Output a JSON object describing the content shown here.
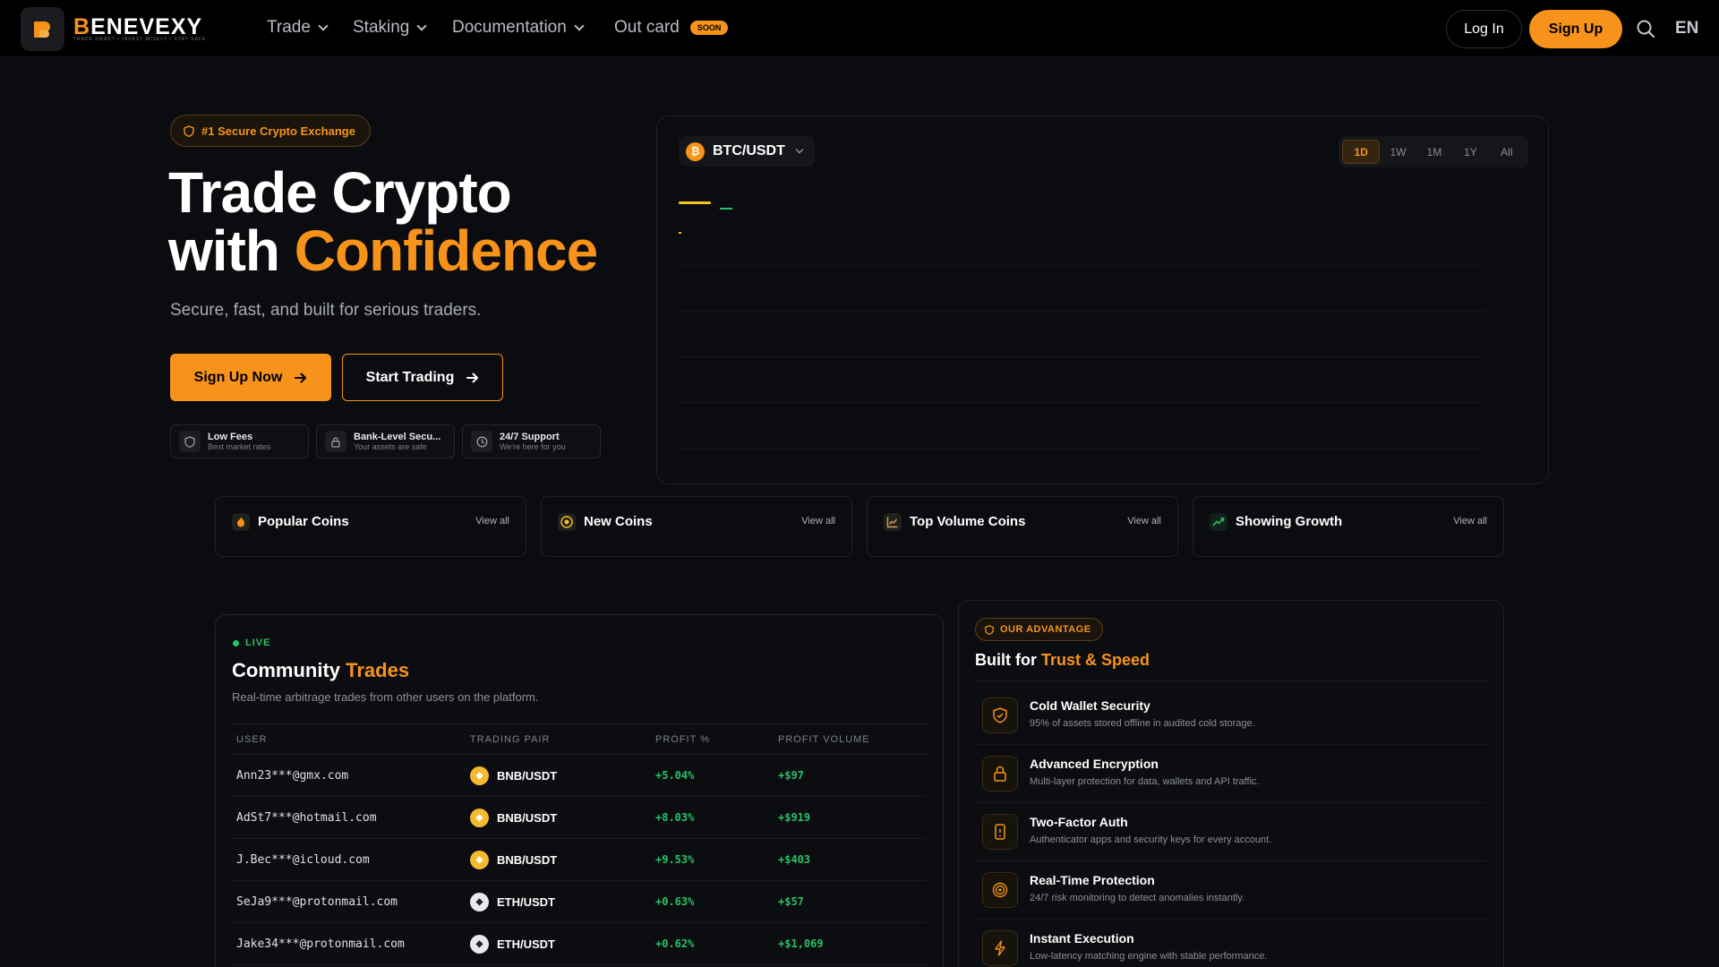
{
  "nav": {
    "brand_first": "B",
    "brand_rest": "ENEVEXY",
    "tagline": "TRADE SMART • INVEST WISELY • STAY SAFE",
    "items": [
      {
        "label": "Trade"
      },
      {
        "label": "Staking"
      },
      {
        "label": "Documentation"
      },
      {
        "label": "Out card"
      }
    ],
    "soon_badge": "SOON",
    "login": "Log In",
    "signup": "Sign Up",
    "language": "EN"
  },
  "hero": {
    "badge": "#1 Secure Crypto Exchange",
    "title_line1": "Trade Crypto",
    "title_line2_plain": "with ",
    "title_line2_accent": "Confidence",
    "subtitle": "Secure, fast, and built for serious traders.",
    "primary_cta": "Sign Up Now",
    "secondary_cta": "Start Trading",
    "features": [
      {
        "title": "Low Fees",
        "subtitle": "Best market rates"
      },
      {
        "title": "Bank-Level Secu...",
        "subtitle": "Your assets are safe"
      },
      {
        "title": "24/7 Support",
        "subtitle": "We're here for you"
      }
    ]
  },
  "chart": {
    "pair": "BTC/USDT",
    "timeframes": [
      "1D",
      "1W",
      "1M",
      "1Y",
      "All"
    ],
    "active_timeframe": "1D"
  },
  "categories": [
    {
      "title": "Popular Coins",
      "link": "View all"
    },
    {
      "title": "New Coins",
      "link": "View all"
    },
    {
      "title": "Top Volume Coins",
      "link": "View all"
    },
    {
      "title": "Showing Growth",
      "link": "View all"
    }
  ],
  "trades": {
    "live_label": "LIVE",
    "title_plain": "Community ",
    "title_accent": "Trades",
    "subtitle": "Real-time arbitrage trades from other users on the platform.",
    "headers": [
      "USER",
      "TRADING PAIR",
      "PROFIT %",
      "PROFIT VOLUME"
    ],
    "rows": [
      {
        "user": "Ann23***@gmx.com",
        "pair": "BNB/USDT",
        "coin": "bnb",
        "profit_pct": "+5.04%",
        "profit_vol": "+$97"
      },
      {
        "user": "AdSt7***@hotmail.com",
        "pair": "BNB/USDT",
        "coin": "bnb",
        "profit_pct": "+8.03%",
        "profit_vol": "+$919"
      },
      {
        "user": "J.Bec***@icloud.com",
        "pair": "BNB/USDT",
        "coin": "bnb",
        "profit_pct": "+9.53%",
        "profit_vol": "+$403"
      },
      {
        "user": "SeJa9***@protonmail.com",
        "pair": "ETH/USDT",
        "coin": "eth",
        "profit_pct": "+0.63%",
        "profit_vol": "+$57"
      },
      {
        "user": "Jake34***@protonmail.com",
        "pair": "ETH/USDT",
        "coin": "eth",
        "profit_pct": "+0.62%",
        "profit_vol": "+$1,069"
      }
    ]
  },
  "advantage": {
    "badge": "OUR ADVANTAGE",
    "title_plain": "Built for ",
    "title_accent": "Trust & Speed",
    "items": [
      {
        "title": "Cold Wallet Security",
        "desc": "95% of assets stored offline in audited cold storage.",
        "icon": "shield-icon"
      },
      {
        "title": "Advanced Encryption",
        "desc": "Multi-layer protection for data, wallets and API traffic.",
        "icon": "lock-icon"
      },
      {
        "title": "Two-Factor Auth",
        "desc": "Authenticator apps and security keys for every account.",
        "icon": "phone-icon"
      },
      {
        "title": "Real-Time Protection",
        "desc": "24/7 risk monitoring to detect anomalies instantly.",
        "icon": "target-icon"
      },
      {
        "title": "Instant Execution",
        "desc": "Low-latency matching engine with stable performance.",
        "icon": "lightning-icon"
      }
    ]
  },
  "colors": {
    "accent": "#f7931a",
    "positive": "#27c265",
    "background": "#0b0c10"
  }
}
